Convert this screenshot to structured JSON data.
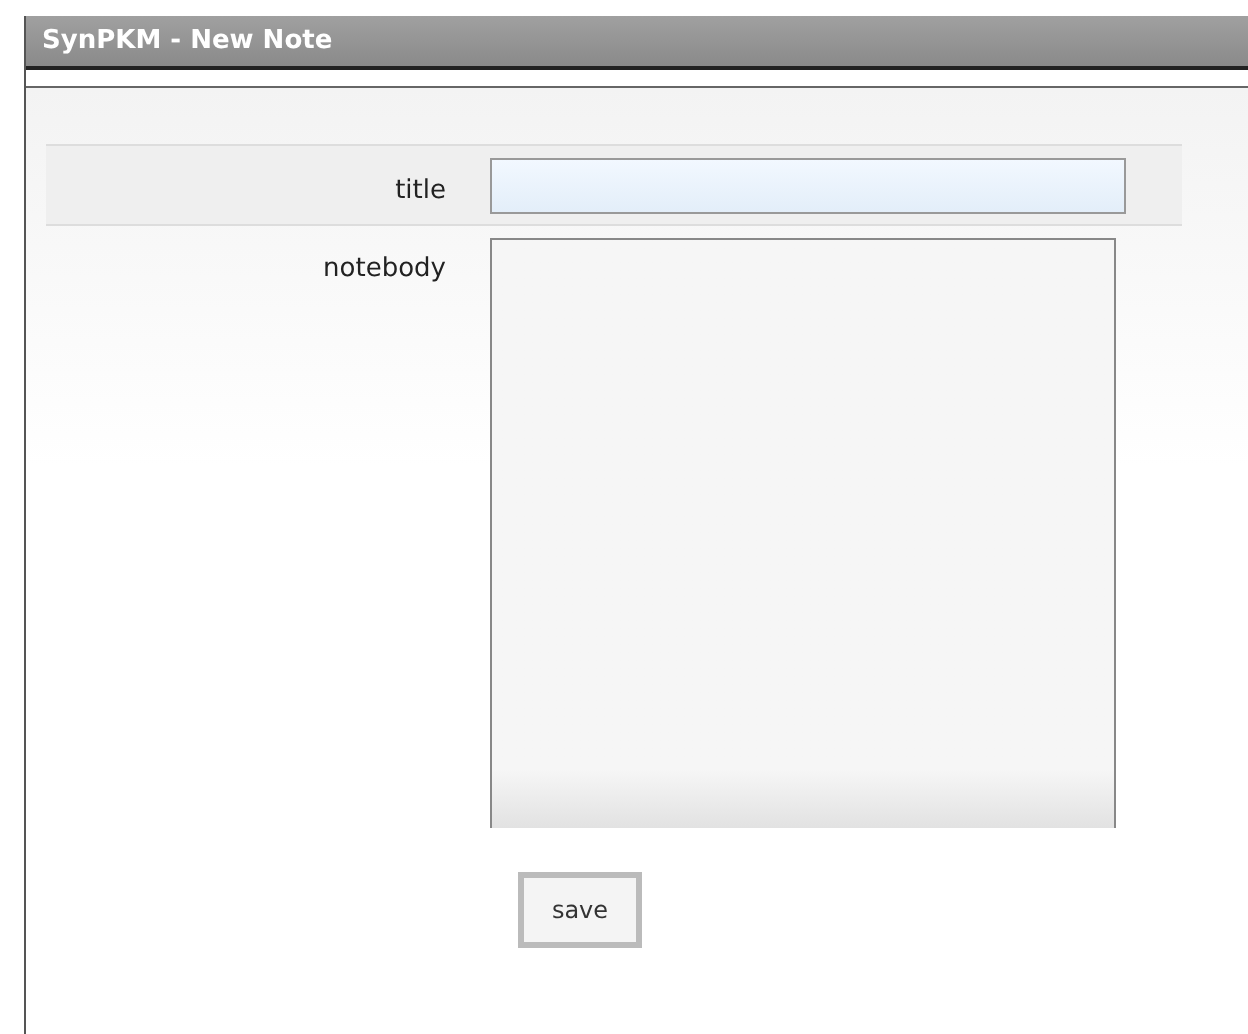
{
  "window": {
    "title": "SynPKM - New Note"
  },
  "form": {
    "fields": [
      {
        "label": "title",
        "kind": "text",
        "focused": true
      },
      {
        "label": "notebody",
        "kind": "textarea",
        "focused": false
      }
    ],
    "button": "save"
  }
}
